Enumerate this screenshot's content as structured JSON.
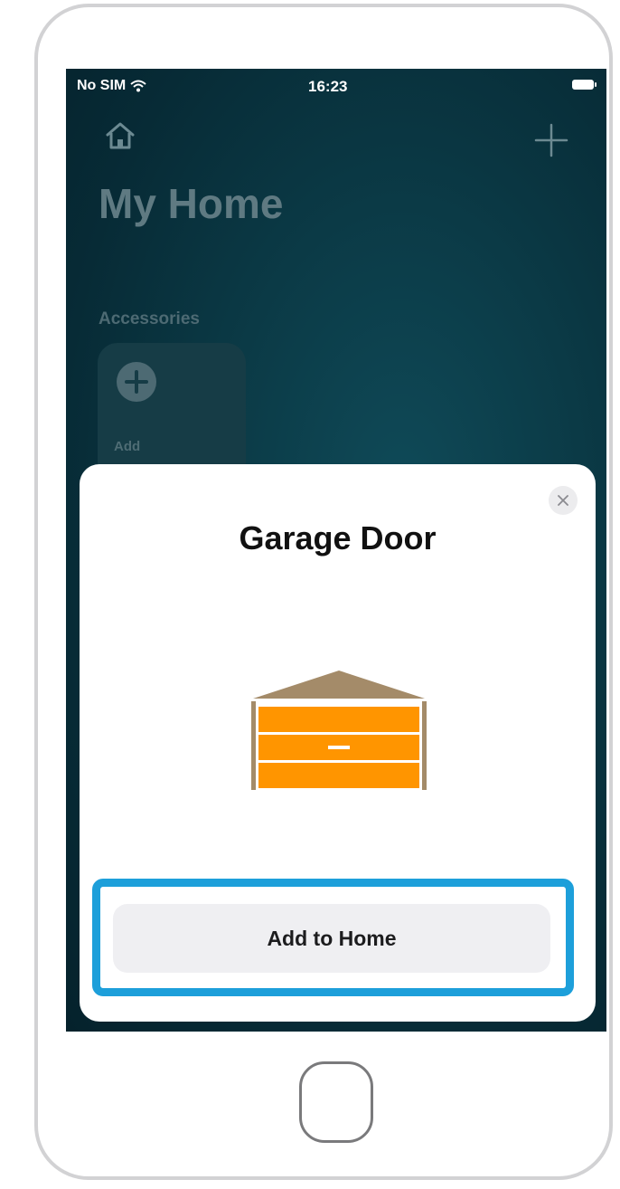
{
  "status_bar": {
    "carrier": "No SIM",
    "time": "16:23"
  },
  "header": {
    "title": "My Home"
  },
  "accessories": {
    "section_label": "Accessories",
    "add_tile_label": "Add"
  },
  "sheet": {
    "title": "Garage Door",
    "primary_button_label": "Add to Home",
    "icons": {
      "close": "close-icon",
      "accessory": "garage-door-icon"
    }
  },
  "colors": {
    "accent_highlight": "#1d9fda",
    "garage_door": "#ff9500",
    "garage_frame": "#a48b69",
    "screen_background": "#0b3a46"
  }
}
